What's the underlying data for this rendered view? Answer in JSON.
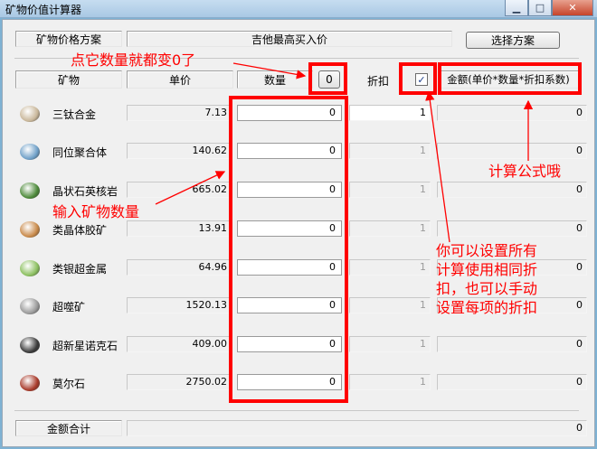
{
  "window": {
    "title": "矿物价值计算器"
  },
  "top": {
    "scheme_label": "矿物价格方案",
    "scheme_value": "吉他最高买入价",
    "choose_button": "选择方案"
  },
  "header": {
    "mineral": "矿物",
    "unit_price": "单价",
    "quantity": "数量",
    "zero_button": "0",
    "discount": "折扣",
    "sync_checkbox": "✓",
    "amount": "金额(单价*数量*折扣系数)"
  },
  "rows": [
    {
      "name": "三钛合金",
      "price": "7.13",
      "qty": "0",
      "discount": "1",
      "amount": "0",
      "icon": "tritanium-icon",
      "color": "#c9b79a"
    },
    {
      "name": "同位聚合体",
      "price": "140.62",
      "qty": "0",
      "discount": "1",
      "amount": "0",
      "icon": "isogen-icon",
      "color": "#6fa0c8"
    },
    {
      "name": "晶状石英核岩",
      "price": "665.02",
      "qty": "0",
      "discount": "1",
      "amount": "0",
      "icon": "nocxium-icon",
      "color": "#4d8a3a"
    },
    {
      "name": "类晶体胶矿",
      "price": "13.91",
      "qty": "0",
      "discount": "1",
      "amount": "0",
      "icon": "pyerite-icon",
      "color": "#c98a4a"
    },
    {
      "name": "类银超金属",
      "price": "64.96",
      "qty": "0",
      "discount": "1",
      "amount": "0",
      "icon": "mexallon-icon",
      "color": "#8cc060"
    },
    {
      "name": "超噬矿",
      "price": "1520.13",
      "qty": "0",
      "discount": "1",
      "amount": "0",
      "icon": "zydrine-icon",
      "color": "#9a9a9a"
    },
    {
      "name": "超新星诺克石",
      "price": "409.00",
      "qty": "0",
      "discount": "1",
      "amount": "0",
      "icon": "megacyte-icon",
      "color": "#3a3a3a"
    },
    {
      "name": "莫尔石",
      "price": "2750.02",
      "qty": "0",
      "discount": "1",
      "amount": "0",
      "icon": "morphite-icon",
      "color": "#a83a2a"
    }
  ],
  "footer": {
    "total_label": "金额合计",
    "total_value": "0"
  },
  "annotations": {
    "zero_note": "点它数量就都变0了",
    "qty_note": "输入矿物数量",
    "formula_note": "计算公式哦",
    "discount_note": [
      "你可以设置所有",
      "计算使用相同折",
      "扣，也可以手动",
      "设置每项的折扣"
    ]
  },
  "colors": {
    "annotation": "#ff0000"
  }
}
